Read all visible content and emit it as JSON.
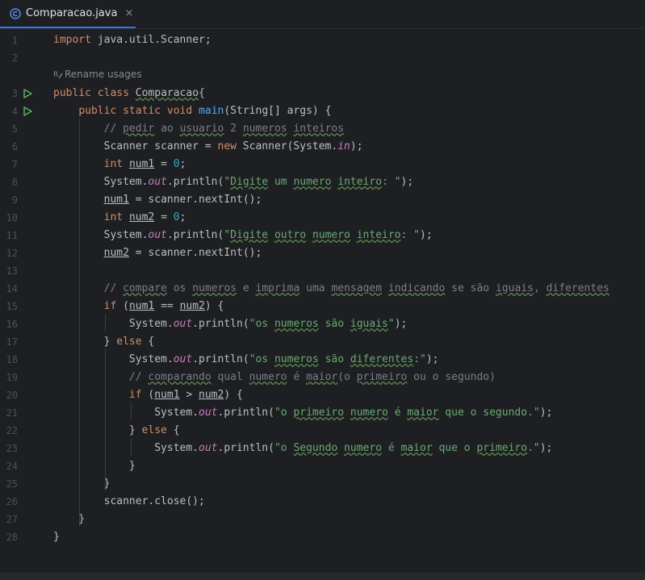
{
  "tab": {
    "title": "Comparacao.java",
    "close_glyph": "×",
    "accent": "#3574f0"
  },
  "hint": {
    "text": "Rename usages",
    "icon": "rename-icon"
  },
  "colors": {
    "background": "#1e1f22",
    "keyword": "#cf8e6d",
    "comment": "#7a7e85",
    "string": "#6aab73",
    "number": "#2aacb8",
    "static_field": "#c77dbb",
    "method_decl": "#56a8f5",
    "run_icon": "#5fb865",
    "default_text": "#bcbec4"
  },
  "lines": [
    {
      "n": "1",
      "code": "import java.util.Scanner;"
    },
    {
      "n": "2",
      "code": ""
    },
    {
      "n": "3",
      "code": "public class Comparacao{",
      "run": true
    },
    {
      "n": "4",
      "code": "    public static void main(String[] args) {",
      "run": true
    },
    {
      "n": "5",
      "code": "        // pedir ao usuario 2 numeros inteiros"
    },
    {
      "n": "6",
      "code": "        Scanner scanner = new Scanner(System.in);"
    },
    {
      "n": "7",
      "code": "        int num1 = 0;"
    },
    {
      "n": "8",
      "code": "        System.out.println(\"Digite um numero inteiro: \");"
    },
    {
      "n": "9",
      "code": "        num1 = scanner.nextInt();"
    },
    {
      "n": "10",
      "code": "        int num2 = 0;"
    },
    {
      "n": "11",
      "code": "        System.out.println(\"Digite outro numero inteiro: \");"
    },
    {
      "n": "12",
      "code": "        num2 = scanner.nextInt();"
    },
    {
      "n": "13",
      "code": ""
    },
    {
      "n": "14",
      "code": "        // compare os numeros e imprima uma mensagem indicando se são iguais, diferentes"
    },
    {
      "n": "15",
      "code": "        if (num1 == num2) {"
    },
    {
      "n": "16",
      "code": "            System.out.println(\"os numeros são iguais\");"
    },
    {
      "n": "17",
      "code": "        } else {"
    },
    {
      "n": "18",
      "code": "            System.out.println(\"os numeros são diferentes:\");"
    },
    {
      "n": "19",
      "code": "            // comparando qual numero é maior(o primeiro ou o segundo)"
    },
    {
      "n": "20",
      "code": "            if (num1 > num2) {"
    },
    {
      "n": "21",
      "code": "                System.out.println(\"o primeiro numero é maior que o segundo.\");"
    },
    {
      "n": "22",
      "code": "            } else {"
    },
    {
      "n": "23",
      "code": "                System.out.println(\"o Segundo numero é maior que o primeiro.\");"
    },
    {
      "n": "24",
      "code": "            }"
    },
    {
      "n": "25",
      "code": "        }"
    },
    {
      "n": "26",
      "code": "        scanner.close();"
    },
    {
      "n": "27",
      "code": "    }"
    },
    {
      "n": "28",
      "code": "}"
    }
  ]
}
